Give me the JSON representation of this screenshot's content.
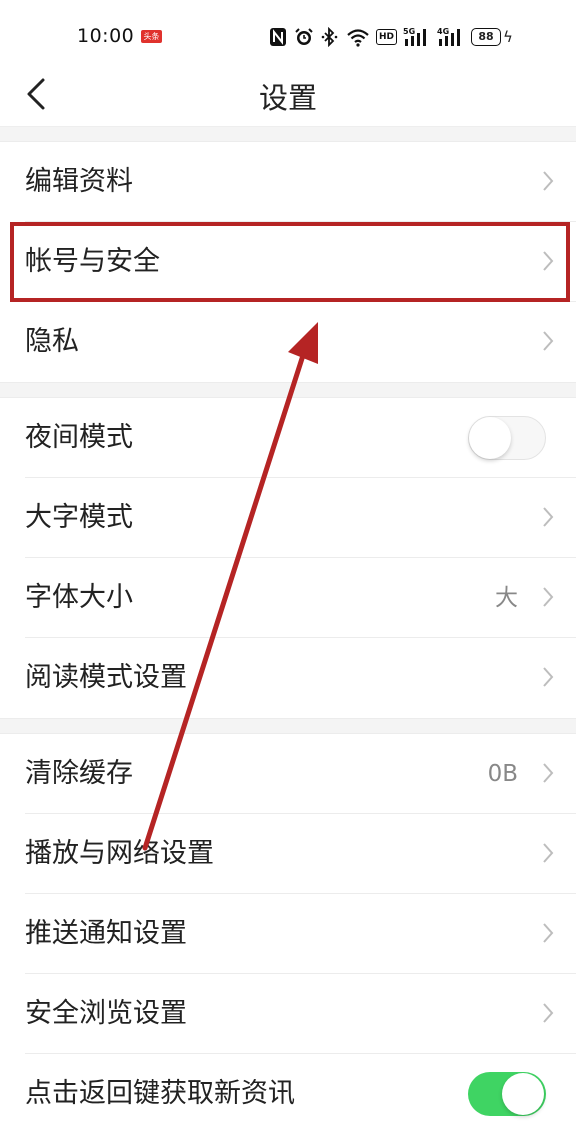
{
  "status_bar": {
    "time": "10:00",
    "news_badge": "头条",
    "battery": "88",
    "hd_label": "HD",
    "sig1": "5G",
    "sig2": "4G"
  },
  "header": {
    "title": "设置"
  },
  "sections": [
    {
      "items": [
        {
          "label": "编辑资料",
          "value": ""
        },
        {
          "label": "帐号与安全",
          "value": ""
        },
        {
          "label": "隐私",
          "value": ""
        }
      ]
    },
    {
      "items": [
        {
          "label": "夜间模式",
          "toggle": "off"
        },
        {
          "label": "大字模式",
          "value": ""
        },
        {
          "label": "字体大小",
          "value": "大"
        },
        {
          "label": "阅读模式设置",
          "value": ""
        }
      ]
    },
    {
      "items": [
        {
          "label": "清除缓存",
          "value": "0B"
        },
        {
          "label": "播放与网络设置",
          "value": ""
        },
        {
          "label": "推送通知设置",
          "value": ""
        },
        {
          "label": "安全浏览设置",
          "value": ""
        },
        {
          "label": "点击返回键获取新资讯",
          "toggle": "on"
        }
      ]
    }
  ],
  "colors": {
    "toggle_on": "#3fd463",
    "highlight_box": "#b52424",
    "arrow": "#b52424"
  }
}
